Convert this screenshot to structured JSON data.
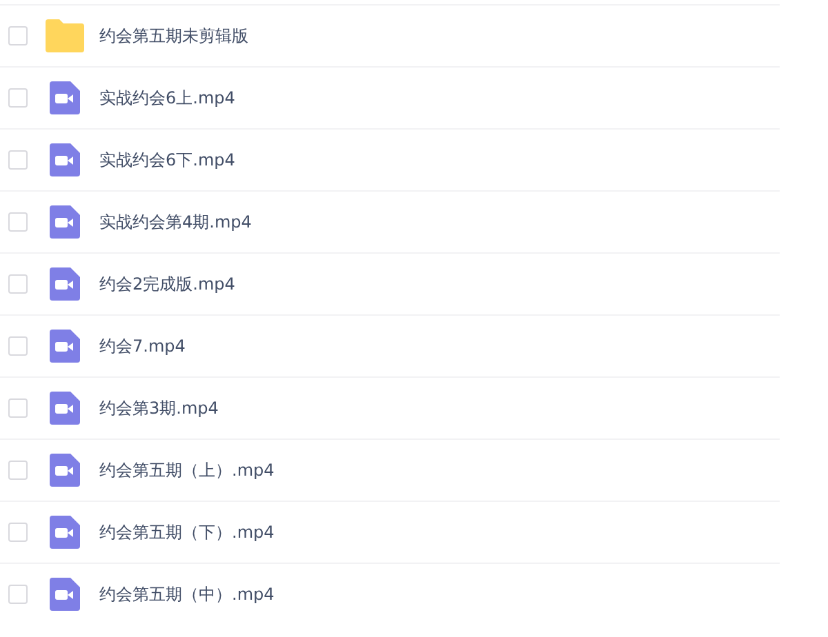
{
  "files": [
    {
      "name": "约会第五期未剪辑版",
      "kind": "folder",
      "checked": false
    },
    {
      "name": "实战约会6上.mp4",
      "kind": "video",
      "checked": false
    },
    {
      "name": "实战约会6下.mp4",
      "kind": "video",
      "checked": false
    },
    {
      "name": "实战约会第4期.mp4",
      "kind": "video",
      "checked": false
    },
    {
      "name": "约会2完成版.mp4",
      "kind": "video",
      "checked": false
    },
    {
      "name": "约会7.mp4",
      "kind": "video",
      "checked": false
    },
    {
      "name": "约会第3期.mp4",
      "kind": "video",
      "checked": false
    },
    {
      "name": "约会第五期（上）.mp4",
      "kind": "video",
      "checked": false
    },
    {
      "name": "约会第五期（下）.mp4",
      "kind": "video",
      "checked": false
    },
    {
      "name": "约会第五期（中）.mp4",
      "kind": "video",
      "checked": false
    }
  ]
}
